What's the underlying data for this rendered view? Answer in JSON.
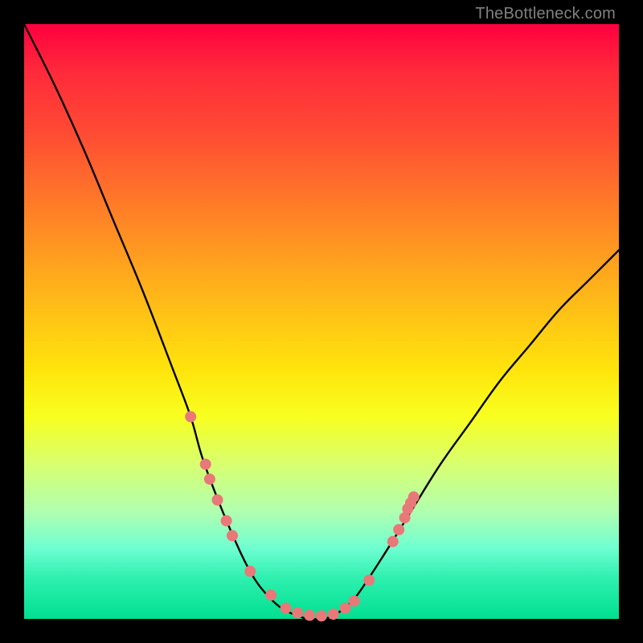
{
  "watermark": "TheBottleneck.com",
  "chart_data": {
    "type": "line",
    "title": "",
    "xlabel": "",
    "ylabel": "",
    "xlim": [
      0,
      100
    ],
    "ylim": [
      0,
      100
    ],
    "grid": false,
    "series": [
      {
        "name": "bottleneck-curve",
        "color": "#000000",
        "x": [
          0,
          5,
          10,
          15,
          20,
          25,
          28,
          30,
          33,
          36,
          38,
          40,
          43,
          46,
          48,
          50,
          52,
          54,
          56,
          60,
          65,
          70,
          75,
          80,
          85,
          90,
          95,
          100
        ],
        "values": [
          100,
          90,
          79,
          67,
          55,
          42,
          34,
          27,
          19,
          12,
          8,
          5,
          2,
          0.5,
          0,
          0,
          0.5,
          2,
          4,
          10,
          18,
          26,
          33,
          40,
          46,
          52,
          57,
          62
        ]
      }
    ],
    "markers": [
      {
        "name": "point",
        "x": 28.0,
        "y": 34.0
      },
      {
        "name": "point",
        "x": 30.5,
        "y": 26.0
      },
      {
        "name": "point",
        "x": 31.2,
        "y": 23.5
      },
      {
        "name": "point",
        "x": 32.5,
        "y": 20.0
      },
      {
        "name": "point",
        "x": 34.0,
        "y": 16.5
      },
      {
        "name": "point",
        "x": 35.0,
        "y": 14.0
      },
      {
        "name": "point",
        "x": 38.0,
        "y": 8.0
      },
      {
        "name": "point",
        "x": 41.5,
        "y": 4.0
      },
      {
        "name": "point",
        "x": 44.0,
        "y": 1.8
      },
      {
        "name": "point",
        "x": 46.0,
        "y": 1.0
      },
      {
        "name": "point",
        "x": 48.0,
        "y": 0.6
      },
      {
        "name": "point",
        "x": 50.0,
        "y": 0.5
      },
      {
        "name": "point",
        "x": 52.0,
        "y": 0.8
      },
      {
        "name": "point",
        "x": 54.0,
        "y": 1.8
      },
      {
        "name": "point",
        "x": 55.5,
        "y": 3.0
      },
      {
        "name": "point",
        "x": 58.0,
        "y": 6.5
      },
      {
        "name": "point",
        "x": 62.0,
        "y": 13.0
      },
      {
        "name": "point",
        "x": 63.0,
        "y": 15.0
      },
      {
        "name": "point",
        "x": 64.0,
        "y": 17.0
      },
      {
        "name": "point",
        "x": 64.5,
        "y": 18.5
      },
      {
        "name": "point",
        "x": 65.0,
        "y": 19.5
      },
      {
        "name": "point",
        "x": 65.5,
        "y": 20.5
      }
    ],
    "marker_style": {
      "color": "#e97878",
      "radius_px": 7
    }
  }
}
